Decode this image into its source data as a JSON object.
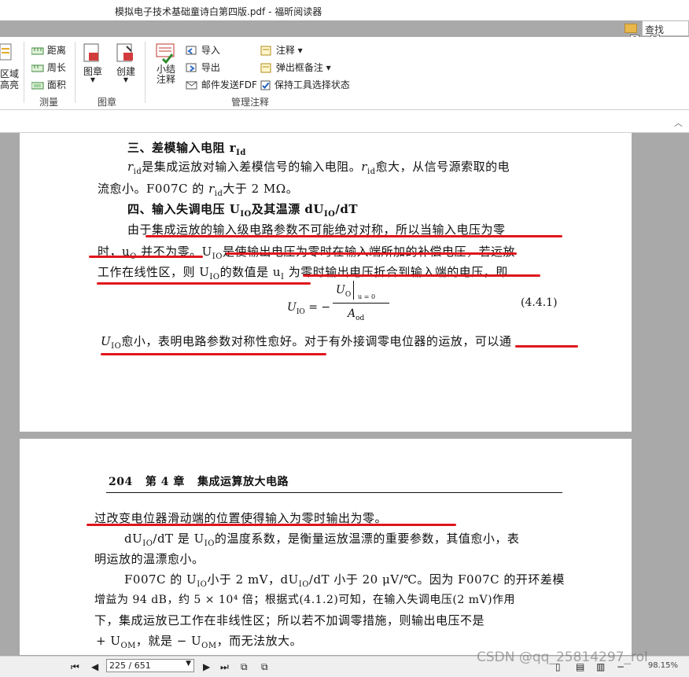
{
  "window": {
    "title": "模拟电子技术基础童诗白第四版.pdf - 福昕阅读器"
  },
  "search": {
    "placeholder": "查找",
    "key_q": "Q",
    "key_d": "D"
  },
  "ribbon": {
    "area_highlight": "区域\n高亮",
    "measure": {
      "items": [
        "距离",
        "周长",
        "面积"
      ],
      "group": "测量"
    },
    "stamp": {
      "stamp_label": "图章",
      "create_label": "创建",
      "group": "图章"
    },
    "comments": {
      "summary_label": "小结\n注释",
      "import": "导入",
      "export": "导出",
      "email_fdf": "邮件发送FDF",
      "annotate": "注释",
      "popup_notes": "弹出框备注",
      "keep_tool": "保持工具选择状态",
      "group": "管理注释"
    }
  },
  "page1": {
    "h3": "三、差模输入电阻 r",
    "h3_sub": "Id",
    "p1a": "是集成运放对输入差模信号的输入电阻。",
    "p1b": "愈大，从信号源索取的电",
    "p1c": "流愈小。F007C 的",
    "p1d": "大于 2 MΩ。",
    "r": "r",
    "rid_sub": "id",
    "h4": "四、输入失调电压 U",
    "h4_b": "及其温漂 dU",
    "h4_c": "/dT",
    "io": "IO",
    "l1": "由于集成运放的输入级电路参数不可能绝对对称，所以当输入电压为零",
    "l2": "时，u",
    "l2o": "O",
    "l2b": " 并不为零。U",
    "l2c": "是使输出电压为零时在输入端所加的补偿电压，若运放",
    "l3": "工作在线性区，则 U",
    "l3b": "的数值是 u",
    "l3i": "I",
    "l3c": " 为零时输出电压折合到输入端的电压，即",
    "eq_lhs": "U",
    "eq_eq": "= −",
    "eq_num": "U",
    "eq_num_sub": "O",
    "eq_cond": "u  = 0",
    "eq_cond_sub": "I",
    "eq_den": "A",
    "eq_den_sub": "od",
    "eq_no": "(4.4.1)",
    "l4": "U",
    "l4b": "愈小，表明电路参数对称性愈好。对于有外接调零电位器的运放，可以通"
  },
  "page2": {
    "header_no": "204",
    "header_ch": "第 4 章",
    "header_title": "集成运算放大电路",
    "l1": "过改变电位器滑动端的位置使得输入为零时输出为零。",
    "l2a": "dU",
    "l2b": "/dT 是 U",
    "l2c": "的温度系数，是衡量运放温漂的重要参数，其值愈小，表",
    "l3": "明运放的温漂愈小。",
    "l4a": "F007C 的 U",
    "l4b": "小于 2 mV，dU",
    "l4c": "/dT 小于 20 μV/℃。因为 F007C 的开环差模",
    "l5": "增益为 94 dB，约 5 × 10⁴ 倍；根据式(4.1.2)可知，在输入失调电压(2 mV)作用",
    "l6": "下，集成运放已工作在非线性区；所以若不加调零措施，则输出电压不是",
    "l7a": "+ U",
    "l7b": "，就是 − U",
    "l7c": "，而无法放大。",
    "om": "OM"
  },
  "statusbar": {
    "page_field": "225 / 651",
    "zoom": "98.15%",
    "watermark": "CSDN @qq_25814297_rol"
  },
  "colors": {
    "underline": "#e0161c"
  }
}
